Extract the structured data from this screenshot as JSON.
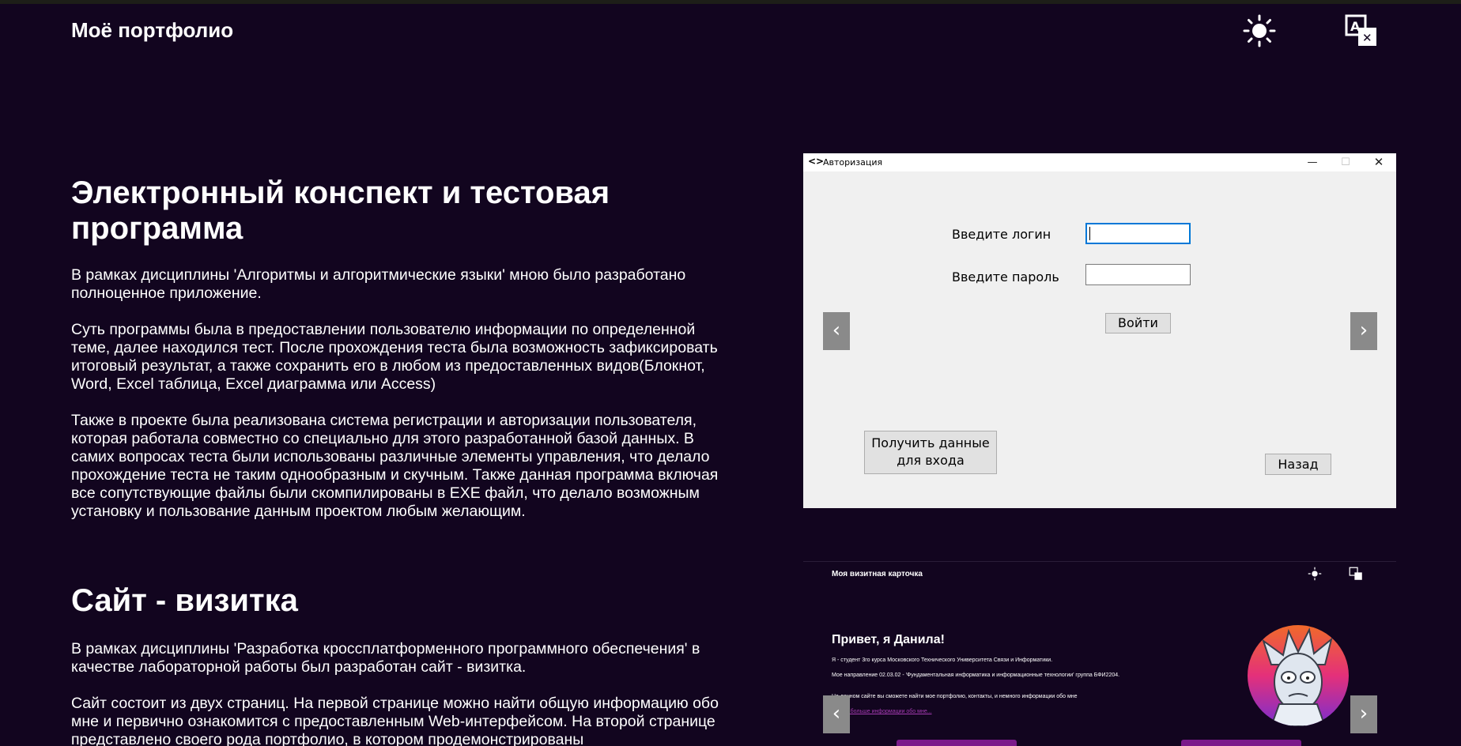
{
  "header": {
    "brand": "Моё портфолио",
    "theme_icon": "sun-icon",
    "lang_icon": "translate-icon"
  },
  "project1": {
    "title": "Электронный конспект и тестовая программа",
    "paragraphs": [
      "В рамках дисциплины 'Алгоритмы и алгоритмические языки' мною было разработано полноценное приложение.",
      "Суть программы была в предоставлении пользователю информации по определенной теме, далее находился тест. После прохождения теста была возможность зафиксировать итоговый результат, а также сохранить его в любом из предоставленных видов(Блокнот, Word, Excel таблица, Excel диаграмма или Access)",
      "Также в проекте была реализована система регистрации и авторизации пользователя, которая работала совместно со специально для этого разработанной базой данных. В самих вопросах теста были использованы различные элементы управления, что делало прохождение теста не таким однообразным и скучным. Также данная программа включая все сопутствующие файлы были скомпилированы в EXE файл, что делало возможным установку и пользование данным проектом любым желающим."
    ]
  },
  "project2": {
    "title": "Сайт - визитка",
    "paragraphs": [
      "В рамках дисциплины 'Разработка кроссплатформенного программного обеспечения' в качестве лабораторной работы был разработан сайт - визитка.",
      "Сайт состоит из двух страниц. На первой странице можно найти общую информацию обо мне и первично ознакомится с предоставленным Web-интерфейсом. На второй странице представлено своего рода портфолио, в котором продемонстрированы"
    ]
  },
  "screenshot1": {
    "window_title": "Авторизация",
    "min": "—",
    "max": "☐",
    "close": "✕",
    "login_label": "Введите логин",
    "password_label": "Введите пароль",
    "login_button": "Войти",
    "get_data_button": "Получить данные для входа",
    "back_button": "Назад"
  },
  "carousel": {
    "prev": "‹",
    "next": "›"
  },
  "screenshot2": {
    "brand": "Моя визитная карточка",
    "hello": "Привет, я Данила!",
    "p1": "Я - студент 3го курса Московского Технического Университета Связи и Информатики.",
    "p2": "Мое направление 02.03.02 - 'Фундаментальная информатика и информационные технологии' группа БФИ2204.",
    "p3": "На данном сайте вы сможете найти мое портфолио, контакты, и немного информации обо мне",
    "link": "Узнать больше информации обо мне..."
  },
  "colors": {
    "background": "#12051f",
    "accent": "#7b1a8a"
  }
}
